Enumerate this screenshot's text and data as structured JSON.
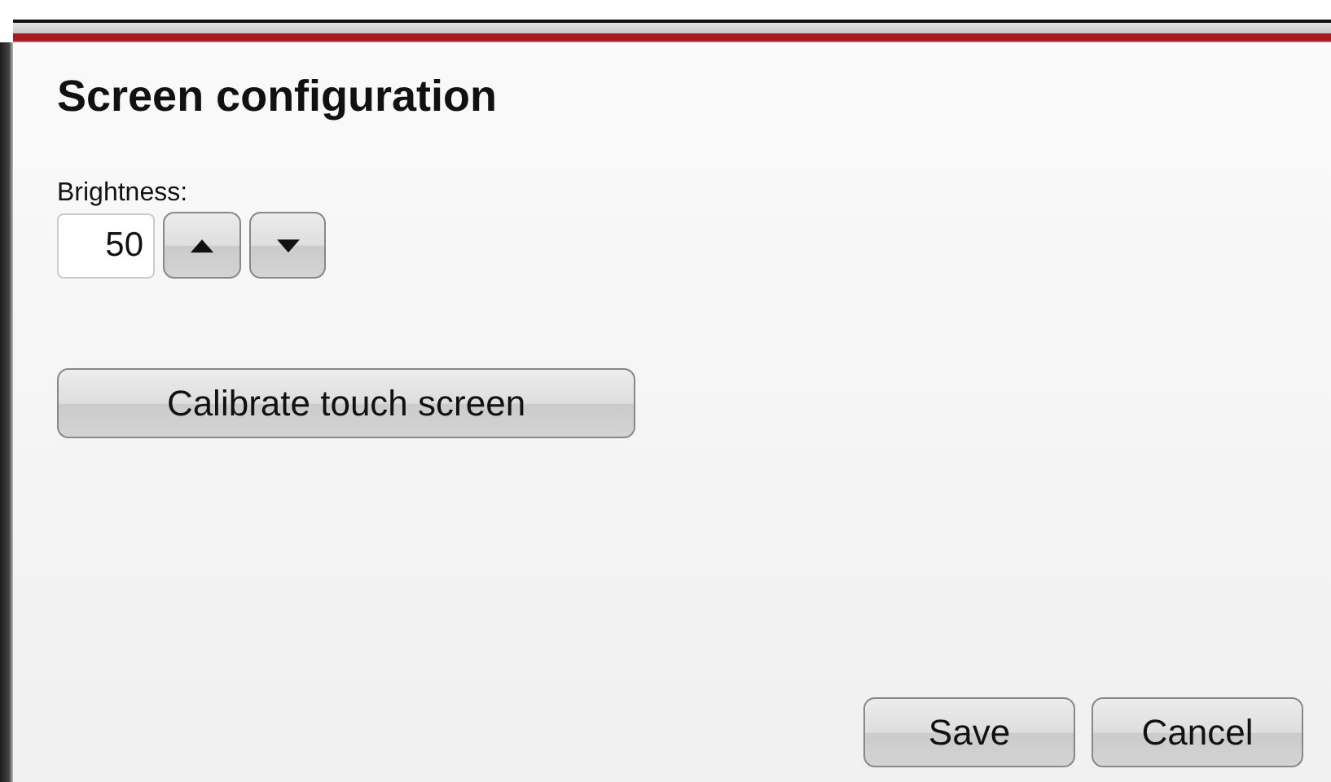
{
  "dialog": {
    "title": "Screen configuration"
  },
  "brightness": {
    "label": "Brightness:",
    "value": "50"
  },
  "calibrate_button": "Calibrate touch screen",
  "buttons": [
    {
      "label": "Save"
    },
    {
      "label": "Cancel"
    }
  ]
}
